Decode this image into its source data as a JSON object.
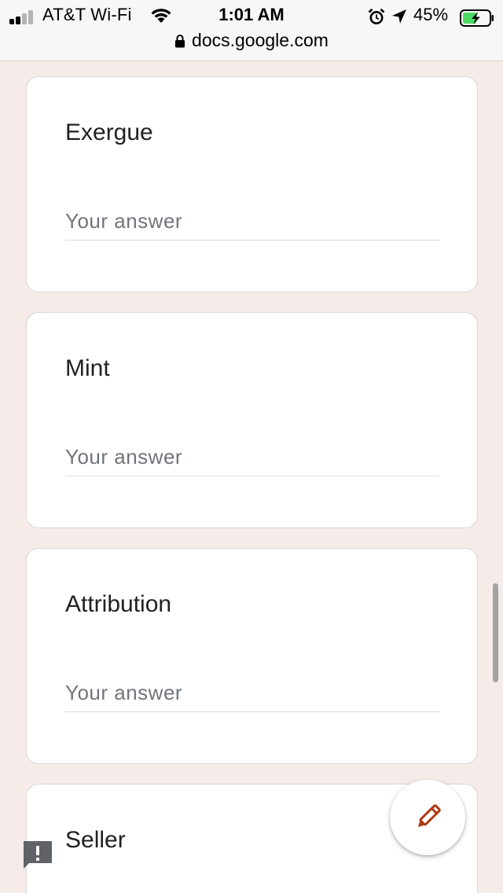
{
  "status_bar": {
    "carrier": "AT&T Wi-Fi",
    "time": "1:01 AM",
    "battery_percent": "45%",
    "signal_bars": 4,
    "signal_bars_filled": 2,
    "icons": [
      "signal-icon",
      "wifi-icon",
      "alarm-icon",
      "location-arrow-icon",
      "battery-charging-icon"
    ]
  },
  "browser": {
    "url": "docs.google.com",
    "lock_icon": "lock-icon"
  },
  "form": {
    "questions": [
      {
        "title": "Exergue",
        "placeholder": "Your answer",
        "value": ""
      },
      {
        "title": "Mint",
        "placeholder": "Your answer",
        "value": ""
      },
      {
        "title": "Attribution",
        "placeholder": "Your answer",
        "value": ""
      },
      {
        "title": "Seller"
      }
    ]
  },
  "fab": {
    "icon": "pencil-icon",
    "color": "#b23a13"
  },
  "report": {
    "icon": "report-issue-icon",
    "color": "#5f6368"
  },
  "colors": {
    "background": "#f5ebe8",
    "card": "#ffffff",
    "text": "#202124",
    "placeholder": "#70757a",
    "battery_fill": "#4cd964"
  }
}
